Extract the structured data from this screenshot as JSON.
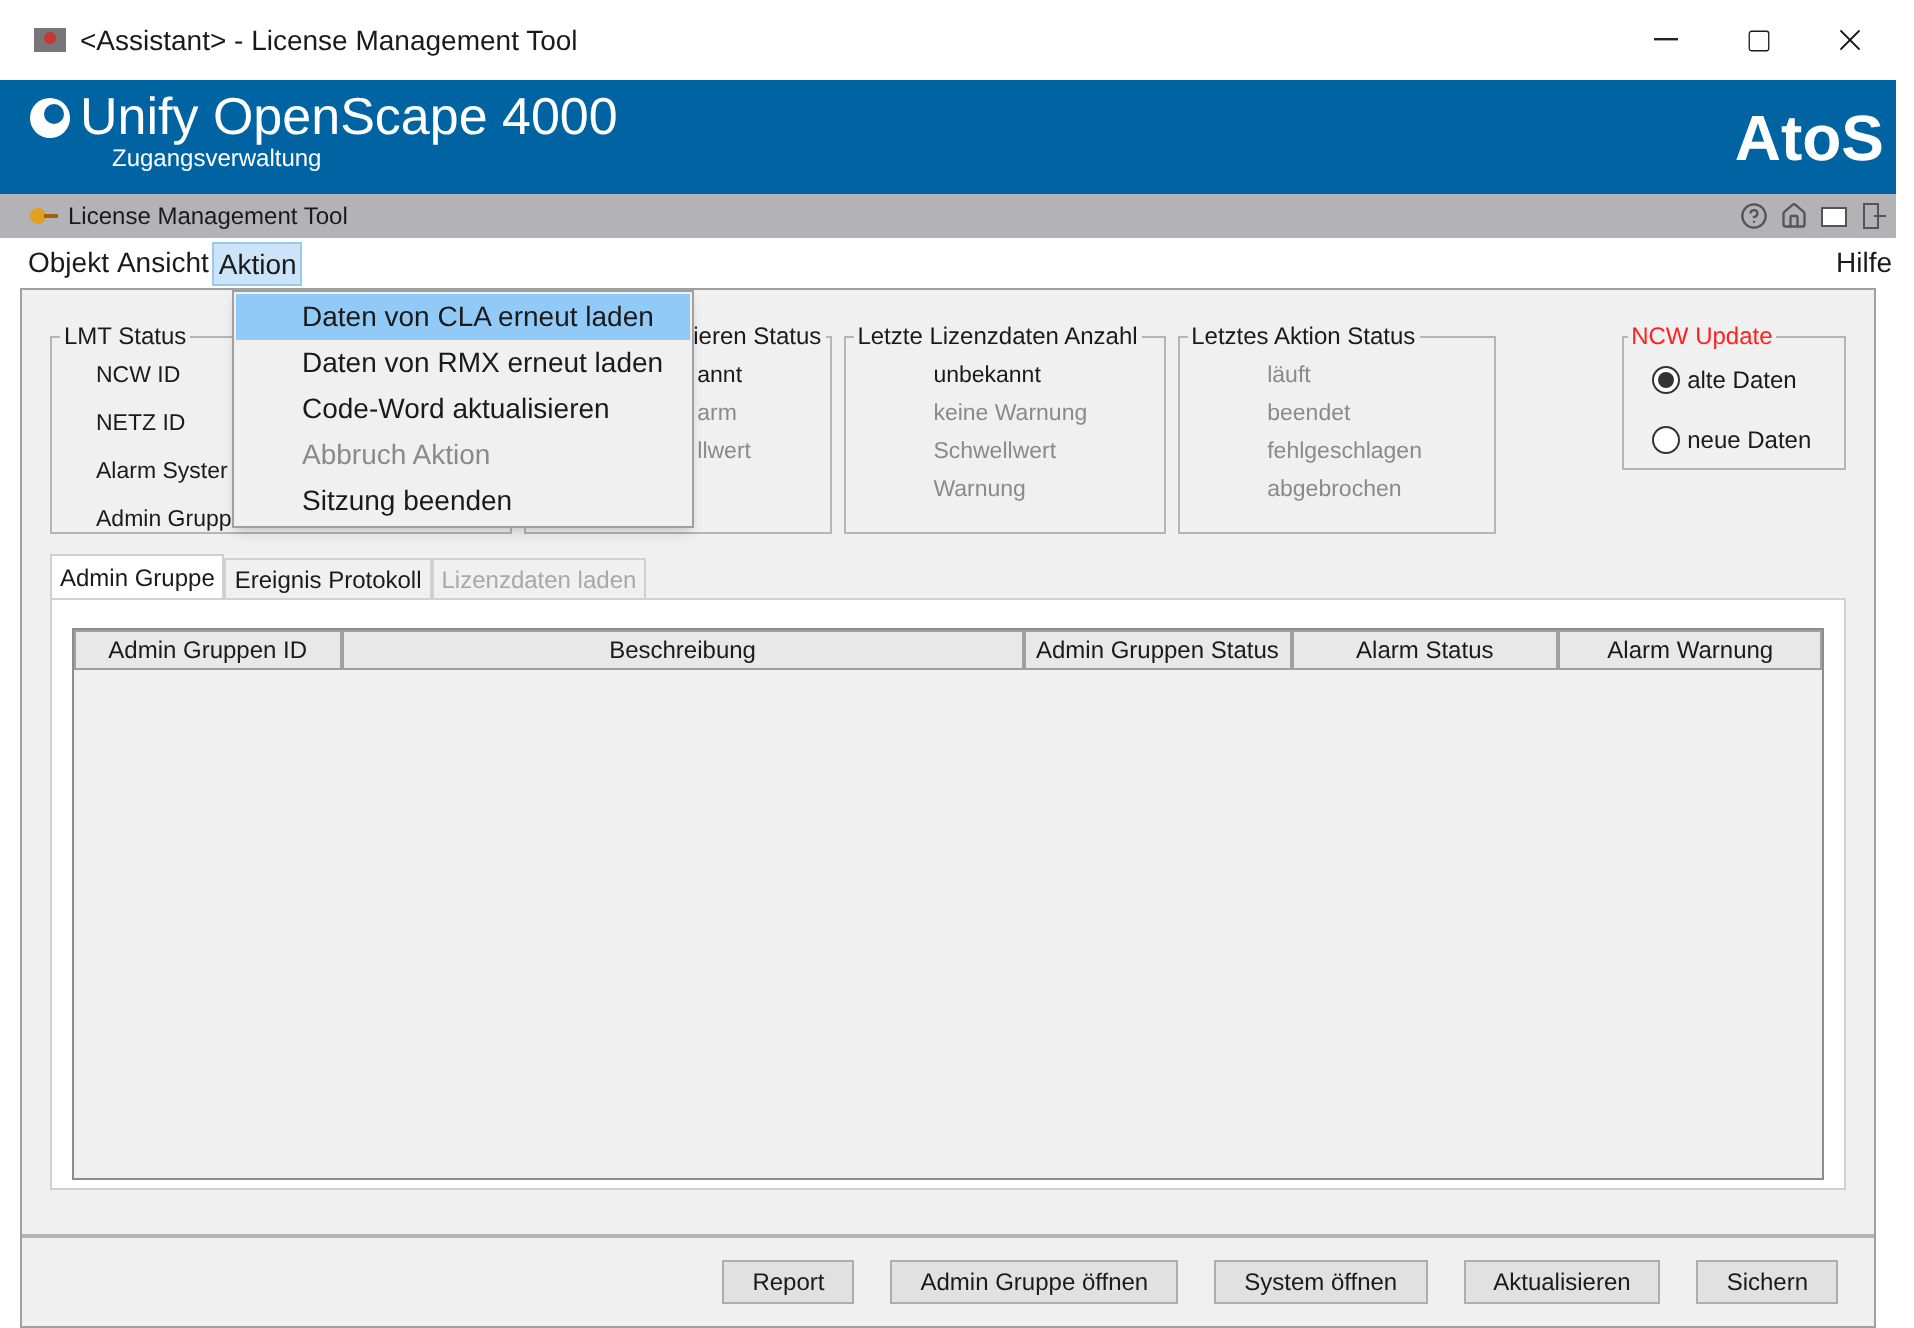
{
  "window": {
    "title": "<Assistant> - License Management Tool"
  },
  "banner": {
    "product": "Unify OpenScape 4000",
    "subtitle": "Zugangsverwaltung",
    "brand": "AtoS"
  },
  "tool_bar": {
    "title": "License Management Tool"
  },
  "menu": {
    "items": [
      {
        "label": "Objekt",
        "selected": false
      },
      {
        "label": "Ansicht",
        "selected": false
      },
      {
        "label": "Aktion",
        "selected": true
      }
    ],
    "help": "Hilfe"
  },
  "dropdown": [
    {
      "label": "Daten von CLA erneut laden",
      "selected": true,
      "disabled": false
    },
    {
      "label": "Daten von RMX erneut laden",
      "selected": false,
      "disabled": false
    },
    {
      "label": "Code-Word aktualisieren",
      "selected": false,
      "disabled": false
    },
    {
      "label": "Abbruch Aktion",
      "selected": false,
      "disabled": true
    },
    {
      "label": "Sitzung beenden",
      "selected": false,
      "disabled": false
    }
  ],
  "status_groups": [
    {
      "title": "LMT Status",
      "items": [
        {
          "label": "NCW ID",
          "active": true
        },
        {
          "label": "NETZ ID",
          "active": true
        },
        {
          "label": "Alarm Syster",
          "active": true
        },
        {
          "label": "Admin Grupp",
          "active": true
        }
      ]
    },
    {
      "title": "ieren Status",
      "items": [
        {
          "label": "annt",
          "active": true
        },
        {
          "label": "arm",
          "active": false
        },
        {
          "label": "llwert",
          "active": false
        }
      ]
    },
    {
      "title": "Letzte Lizenzdaten Anzahl",
      "items": [
        {
          "label": "unbekannt",
          "active": true
        },
        {
          "label": "keine Warnung",
          "active": false
        },
        {
          "label": "Schwellwert",
          "active": false
        },
        {
          "label": "Warnung",
          "active": false
        }
      ]
    },
    {
      "title": "Letztes Aktion Status",
      "items": [
        {
          "label": "läuft",
          "active": false
        },
        {
          "label": "beendet",
          "active": false
        },
        {
          "label": "fehlgeschlagen",
          "active": false
        },
        {
          "label": "abgebrochen",
          "active": false
        }
      ]
    }
  ],
  "ncw_update": {
    "title": "NCW Update",
    "options": [
      {
        "label": "alte Daten",
        "selected": true
      },
      {
        "label": "neue Daten",
        "selected": false
      }
    ]
  },
  "tabs": [
    {
      "label": "Admin Gruppe",
      "selected": true,
      "disabled": false
    },
    {
      "label": "Ereignis Protokoll",
      "selected": false,
      "disabled": false
    },
    {
      "label": "Lizenzdaten laden",
      "selected": false,
      "disabled": true
    }
  ],
  "table": {
    "columns": [
      "Admin Gruppen ID",
      "Beschreibung",
      "Admin Gruppen Status",
      "Alarm Status",
      "Alarm Warnung"
    ]
  },
  "buttons": [
    "Report",
    "Admin Gruppe öffnen",
    "System öffnen",
    "Aktualisieren",
    "Sichern"
  ]
}
